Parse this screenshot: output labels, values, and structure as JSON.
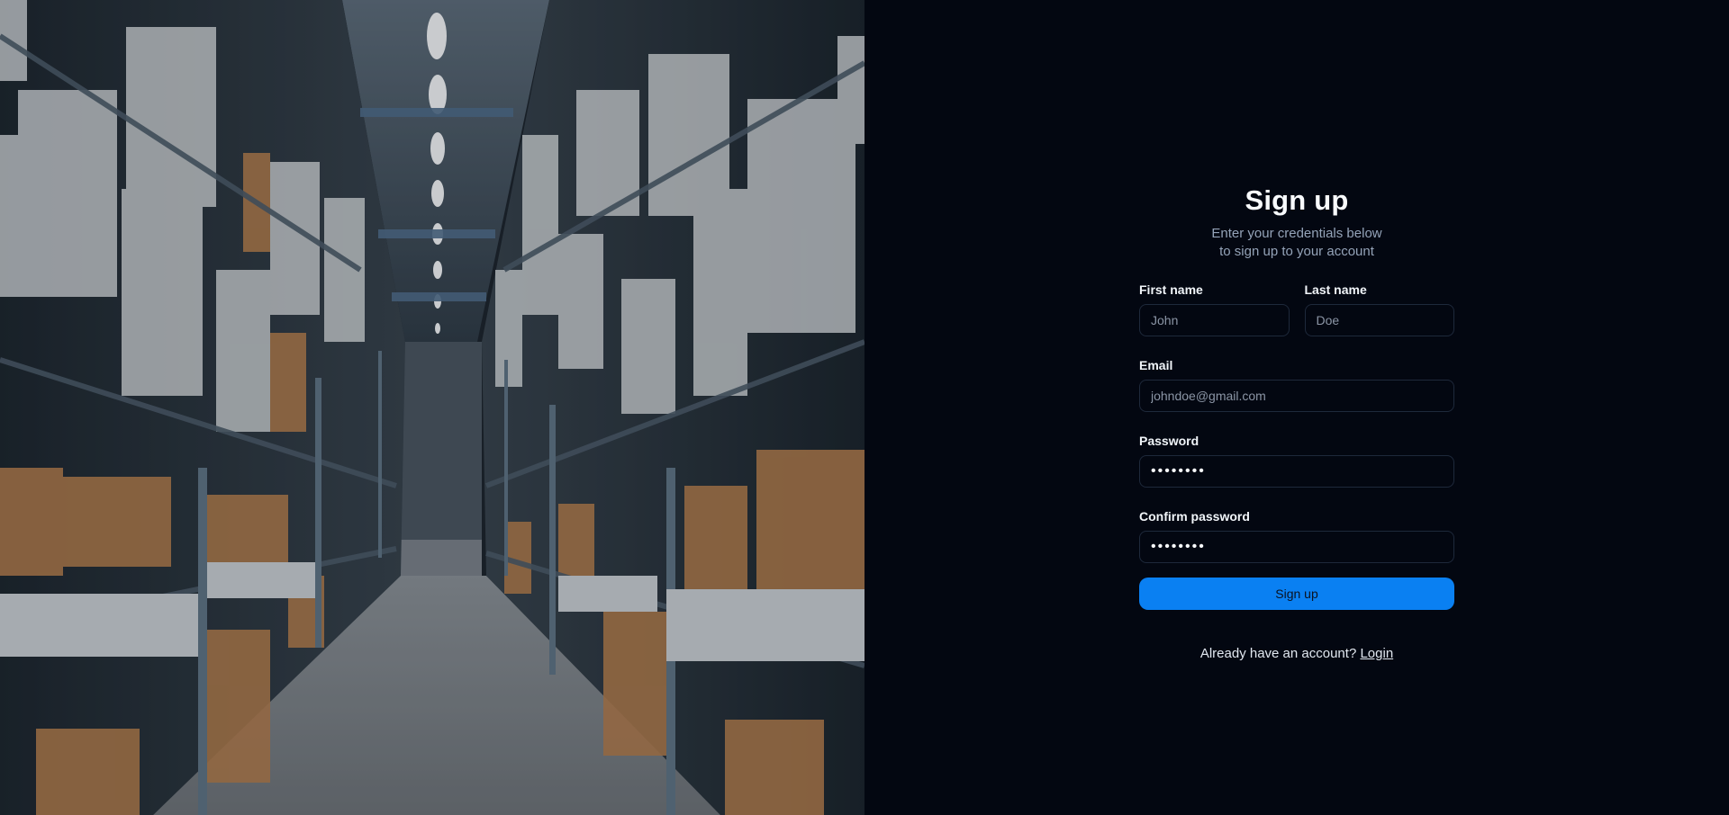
{
  "hero": {
    "image_description": "warehouse-aisle-photo"
  },
  "form": {
    "title": "Sign up",
    "subtitle_line1": "Enter your credentials below",
    "subtitle_line2": "to sign up to your account",
    "first_name": {
      "label": "First name",
      "placeholder": "John",
      "value": ""
    },
    "last_name": {
      "label": "Last name",
      "placeholder": "Doe",
      "value": ""
    },
    "email": {
      "label": "Email",
      "placeholder": "johndoe@gmail.com",
      "value": ""
    },
    "password": {
      "label": "Password",
      "value": "password"
    },
    "confirm_password": {
      "label": "Confirm password",
      "value": "password"
    },
    "submit_label": "Sign up",
    "footer_text": "Already have an account?",
    "login_link": "Login"
  },
  "colors": {
    "background": "#030711",
    "accent": "#0a80f2",
    "input_border": "#1e293b",
    "muted_text": "#94a3b8"
  }
}
